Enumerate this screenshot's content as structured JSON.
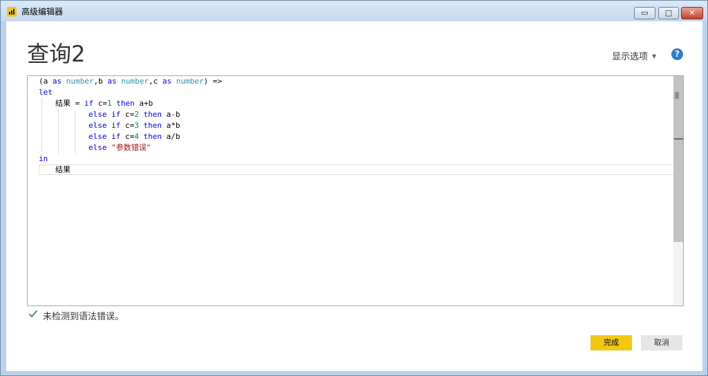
{
  "window": {
    "title": "高级编辑器",
    "min_glyph": "▭",
    "max_glyph": "□",
    "close_glyph": "✕"
  },
  "header": {
    "query_title": "查询2",
    "display_options": "显示选项",
    "help_glyph": "?"
  },
  "code": {
    "l1": [
      "(a ",
      "as",
      " ",
      "number",
      ",b ",
      "as",
      " ",
      "number",
      ",c ",
      "as",
      " ",
      "number",
      ") =>"
    ],
    "l2": "let",
    "l3": [
      "结果",
      " = ",
      "if",
      " c=",
      "1",
      " ",
      "then",
      " a+b"
    ],
    "l4": [
      "else",
      " ",
      "if",
      " c=",
      "2",
      " ",
      "then",
      " a-b"
    ],
    "l5": [
      "else",
      " ",
      "if",
      " c=",
      "3",
      " ",
      "then",
      " a*b"
    ],
    "l6": [
      "else",
      " ",
      "if",
      " c=",
      "4",
      " ",
      "then",
      " a/b"
    ],
    "l7": [
      "else",
      " ",
      "\"参数错误\""
    ],
    "l8": "in",
    "l9": "结果"
  },
  "status": {
    "message": "未检测到语法错误。",
    "icon": "check-icon"
  },
  "buttons": {
    "done": "完成",
    "cancel": "取消"
  },
  "colors": {
    "accent": "#f2c811",
    "keyword": "#0000ff",
    "type": "#2b91af",
    "number": "#098658",
    "string": "#a31515",
    "check": "#4a8f78"
  }
}
